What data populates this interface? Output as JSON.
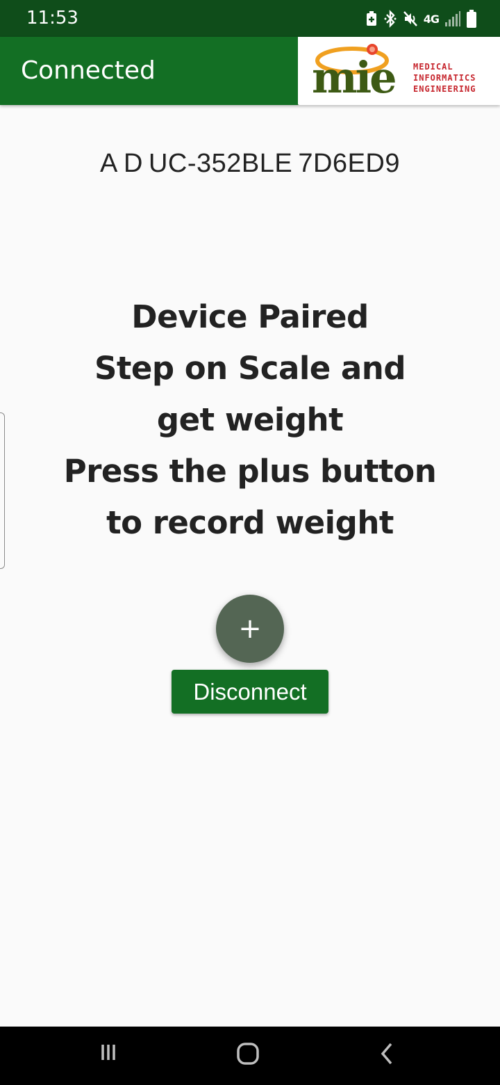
{
  "status_bar": {
    "time": "11:53",
    "network": "4G",
    "icons": [
      "battery-saver-icon",
      "bluetooth-icon",
      "mute-icon",
      "network-4g-icon",
      "signal-icon",
      "battery-icon"
    ]
  },
  "app_bar": {
    "title": "Connected",
    "logo": {
      "wordmark": "mie",
      "line1": "MEDICAL",
      "line2": "INFORMATICS",
      "line3": "ENGINEERING"
    }
  },
  "device": {
    "id": "A D UC-352BLE 7D6ED9"
  },
  "instructions": {
    "line1": "Device Paired",
    "line2": "Step on Scale and",
    "line3": "get weight",
    "line4": "Press the plus button",
    "line5": "to record weight"
  },
  "actions": {
    "add_glyph": "+",
    "disconnect_label": "Disconnect"
  },
  "nav_bar": {
    "icons": [
      "recent-apps-icon",
      "home-icon",
      "back-icon"
    ]
  },
  "colors": {
    "status_bar": "#0f4d1a",
    "app_bar": "#136f24",
    "fab": "#546654",
    "background": "#fafafa",
    "logo_red": "#c6252d",
    "logo_green": "#3d5a14",
    "logo_orange": "#f0a020"
  }
}
